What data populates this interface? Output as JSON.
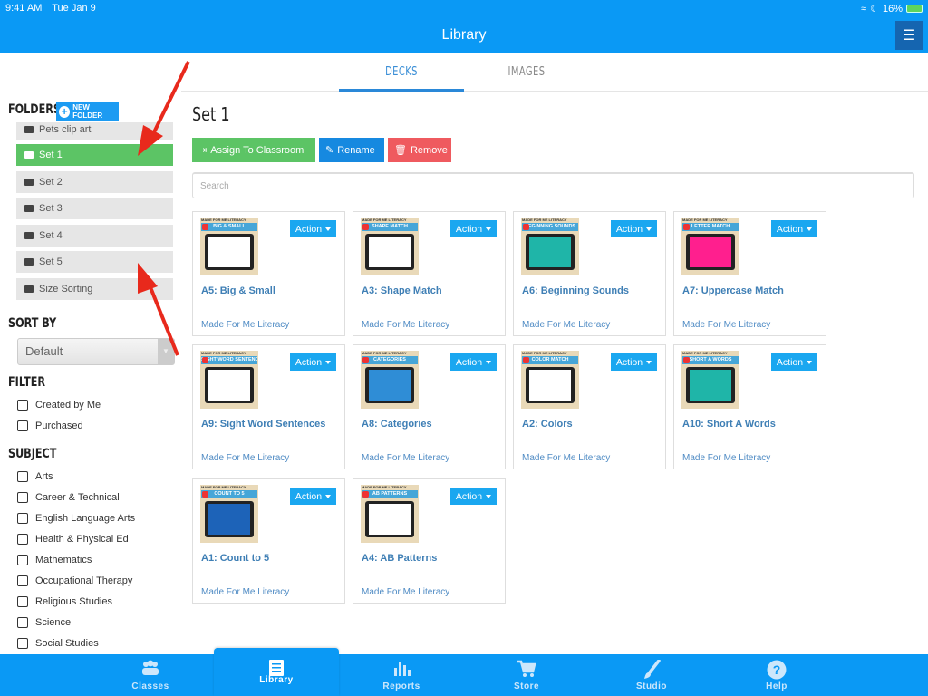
{
  "status_bar": {
    "time": "9:41 AM",
    "date": "Tue Jan 9",
    "battery": "16%"
  },
  "header": {
    "title": "Library",
    "menu_icon": "hamburger-menu-icon"
  },
  "tabs": [
    {
      "label": "DECKS",
      "active": true
    },
    {
      "label": "IMAGES",
      "active": false
    }
  ],
  "sidebar": {
    "folders_heading": "FOLDERS",
    "new_folder_label": "NEW FOLDER",
    "folders": [
      {
        "label": "Pets clip art",
        "active": false
      },
      {
        "label": "Set 1",
        "active": true
      },
      {
        "label": "Set 2",
        "active": false
      },
      {
        "label": "Set 3",
        "active": false
      },
      {
        "label": "Set 4",
        "active": false
      },
      {
        "label": "Set 5",
        "active": false
      },
      {
        "label": "Size Sorting",
        "active": false
      }
    ],
    "sort_heading": "SORT BY",
    "sort_value": "Default",
    "filter_heading": "FILTER",
    "filters": [
      {
        "label": "Created by Me",
        "checked": false
      },
      {
        "label": "Purchased",
        "checked": false
      }
    ],
    "subject_heading": "SUBJECT",
    "subjects": [
      {
        "label": "Arts",
        "checked": false
      },
      {
        "label": "Career & Technical",
        "checked": false
      },
      {
        "label": "English Language Arts",
        "checked": false
      },
      {
        "label": "Health & Physical Ed",
        "checked": false
      },
      {
        "label": "Mathematics",
        "checked": false
      },
      {
        "label": "Occupational Therapy",
        "checked": false
      },
      {
        "label": "Religious Studies",
        "checked": false
      },
      {
        "label": "Science",
        "checked": false
      },
      {
        "label": "Social Studies",
        "checked": false
      }
    ]
  },
  "main": {
    "title": "Set 1",
    "buttons": {
      "assign": "Assign To Classroom",
      "rename": "Rename",
      "remove": "Remove"
    },
    "search_placeholder": "Search",
    "action_label": "Action",
    "brand_text": "MADE FOR ME LITERACY",
    "decks": [
      {
        "title": "A5: Big & Small",
        "thumb_title": "BIG & SMALL",
        "author": "Made For Me Literacy"
      },
      {
        "title": "A3: Shape Match",
        "thumb_title": "SHAPE MATCH",
        "author": "Made For Me Literacy"
      },
      {
        "title": "A6: Beginning Sounds",
        "thumb_title": "BEGINNING SOUNDS",
        "author": "Made For Me Literacy"
      },
      {
        "title": "A7: Uppercase Match",
        "thumb_title": "LETTER MATCH",
        "author": "Made For Me Literacy"
      },
      {
        "title": "A9: Sight Word Sentences",
        "thumb_title": "SIGHT WORD SENTENCES",
        "author": "Made For Me Literacy"
      },
      {
        "title": "A8: Categories",
        "thumb_title": "CATEGORIES",
        "author": "Made For Me Literacy"
      },
      {
        "title": "A2: Colors",
        "thumb_title": "COLOR MATCH",
        "author": "Made For Me Literacy"
      },
      {
        "title": "A10: Short A Words",
        "thumb_title": "SHORT A WORDS",
        "author": "Made For Me Literacy"
      },
      {
        "title": "A1: Count to 5",
        "thumb_title": "COUNT TO 5",
        "author": "Made For Me Literacy"
      },
      {
        "title": "A4: AB Patterns",
        "thumb_title": "AB PATTERNS",
        "author": "Made For Me Literacy"
      }
    ]
  },
  "bottom_nav": [
    {
      "label": "Classes",
      "icon": "people-icon",
      "active": false
    },
    {
      "label": "Library",
      "icon": "book-icon",
      "active": true
    },
    {
      "label": "Reports",
      "icon": "bar-chart-icon",
      "active": false
    },
    {
      "label": "Store",
      "icon": "cart-icon",
      "active": false
    },
    {
      "label": "Studio",
      "icon": "paintbrush-icon",
      "active": false
    },
    {
      "label": "Help",
      "icon": "help-icon",
      "active": false
    }
  ],
  "colors": {
    "brand_blue": "#0a99f5",
    "active_green": "#5cc465",
    "rename_blue": "#1689e0",
    "remove_red": "#ef5a5f",
    "action_blue": "#1aa7f0",
    "annotation_red": "#e8291c"
  }
}
